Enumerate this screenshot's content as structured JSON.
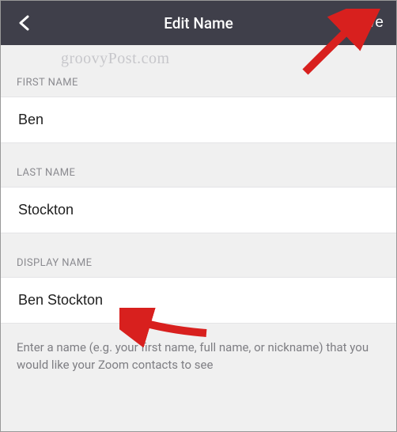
{
  "header": {
    "title": "Edit Name",
    "save_label": "Save"
  },
  "watermark": "groovyPost.com",
  "sections": {
    "first_name": {
      "label": "FIRST NAME",
      "value": "Ben"
    },
    "last_name": {
      "label": "LAST NAME",
      "value": "Stockton"
    },
    "display_name": {
      "label": "DISPLAY NAME",
      "value": "Ben Stockton"
    }
  },
  "help_text": "Enter a name (e.g. your first name, full name, or nickname) that you would like your Zoom contacts to see"
}
